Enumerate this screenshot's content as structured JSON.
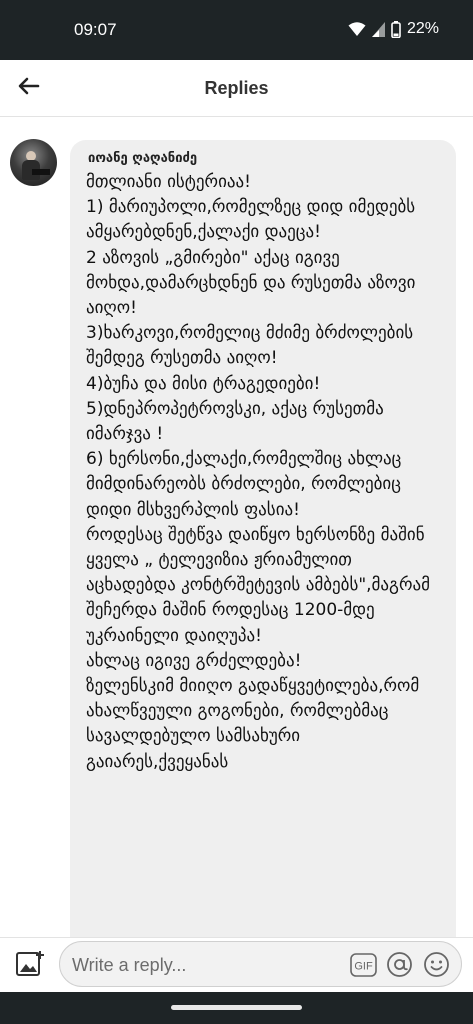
{
  "status_bar": {
    "time": "09:07",
    "battery": "22%"
  },
  "header": {
    "title": "Replies"
  },
  "reply": {
    "author": "იოანე ღაღანიძე",
    "text": "მთლიანი ისტერიაა!\n1) მარიუპოლი,რომელზეც დიდ იმედებს ამყარებდნენ,ქალაქი დაეცა!\n2 აზოვის „გმირები\" აქაც იგივე მოხდა,დამარცხდნენ და რუსეთმა აზოვი აიღო!\n3)ხარკოვი,რომელიც მძიმე ბრძოლების შემდეგ რუსეთმა აიღო!\n4)ბუჩა და მისი ტრაგედიები!\n5)დნეპროპეტროვსკი, აქაც რუსეთმა იმარჯვა !\n6) ხერსონი,ქალაქი,რომელშიც ახლაც მიმდინარეობს ბრძოლები, რომლებიც დიდი მსხვერპლის ფასია!\nროდესაც შეტწვა დაიწყო ხერსონზე მაშინ ყველა „ ტელევიზია ჟრიამულით აცხადებდა კონტრშეტევის ამბებს\",მაგრამ შეჩერდა მაშინ როდესაც 1200-მდე უკრაინელი დაიღუპა!\nახლაც იგივე გრძელდება!\nზელენსკიმ მიიღო გადაწყვეტილება,რომ ახალწვეული გოგონები, რომლებმაც სავალდებულო სამსახური გაიარეს,ქვეყანას"
  },
  "compose": {
    "placeholder": "Write a reply...",
    "gif_label": "GIF"
  },
  "icons": {
    "back": "arrow-left-icon",
    "wifi": "wifi-icon",
    "signal": "signal-icon",
    "battery": "battery-icon",
    "add_image": "image-icon",
    "gif": "gif-icon",
    "mention": "at-icon",
    "emoji": "emoji-icon"
  }
}
